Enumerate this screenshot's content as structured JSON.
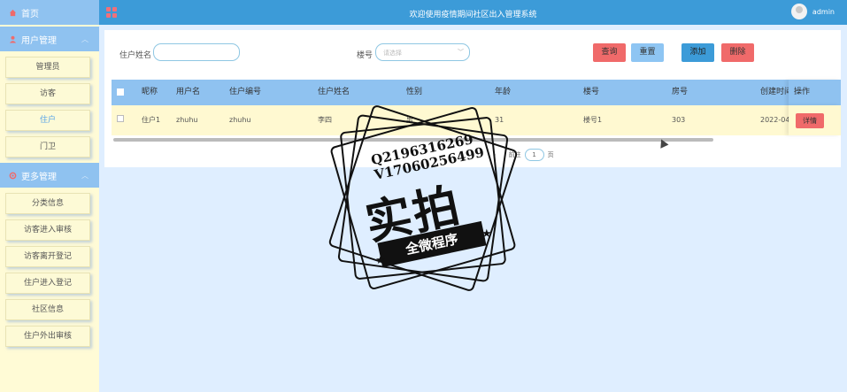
{
  "sidebar": {
    "home": "首页",
    "groups": [
      {
        "title": "用户管理",
        "items": [
          {
            "label": "管理员"
          },
          {
            "label": "访客"
          },
          {
            "label": "住户"
          },
          {
            "label": "门卫"
          }
        ]
      },
      {
        "title": "更多管理",
        "items": [
          {
            "label": "分类信息"
          },
          {
            "label": "访客进入审核"
          },
          {
            "label": "访客离开登记"
          },
          {
            "label": "住户进入登记"
          },
          {
            "label": "社区信息"
          },
          {
            "label": "住户外出审核"
          }
        ]
      }
    ],
    "active_item": "住户"
  },
  "topbar": {
    "title": "欢迎使用疫情期间社区出入管理系统",
    "username": "admin"
  },
  "search": {
    "name_label": "住户姓名",
    "name_value": "",
    "building_label": "楼号",
    "building_placeholder": "请选择"
  },
  "buttons": {
    "query": "查询",
    "reset": "重置",
    "add": "添加",
    "delete": "删除",
    "detail": "详情"
  },
  "table": {
    "columns": [
      "昵称",
      "用户名",
      "住户编号",
      "住户姓名",
      "性别",
      "年龄",
      "楼号",
      "房号",
      "创建时间",
      "操作"
    ],
    "rows": [
      {
        "nickname": "住户1",
        "username": "zhuhu",
        "number": "zhuhu",
        "name": "李四",
        "gender": "男",
        "age": "31",
        "building": "楼号1",
        "room": "303",
        "created": "2022-04"
      }
    ]
  },
  "pager": {
    "goto_label": "前往",
    "page": "1",
    "page_suffix": "页"
  },
  "stamp": {
    "line1": "Q2196316269",
    "line2": "V17060256499",
    "big": "实拍",
    "ribbon": "全微程序"
  },
  "colors": {
    "topbar": "#3c9bd8",
    "header": "#8fc2f0",
    "row": "#fff9d1",
    "danger": "#f06a6a"
  }
}
